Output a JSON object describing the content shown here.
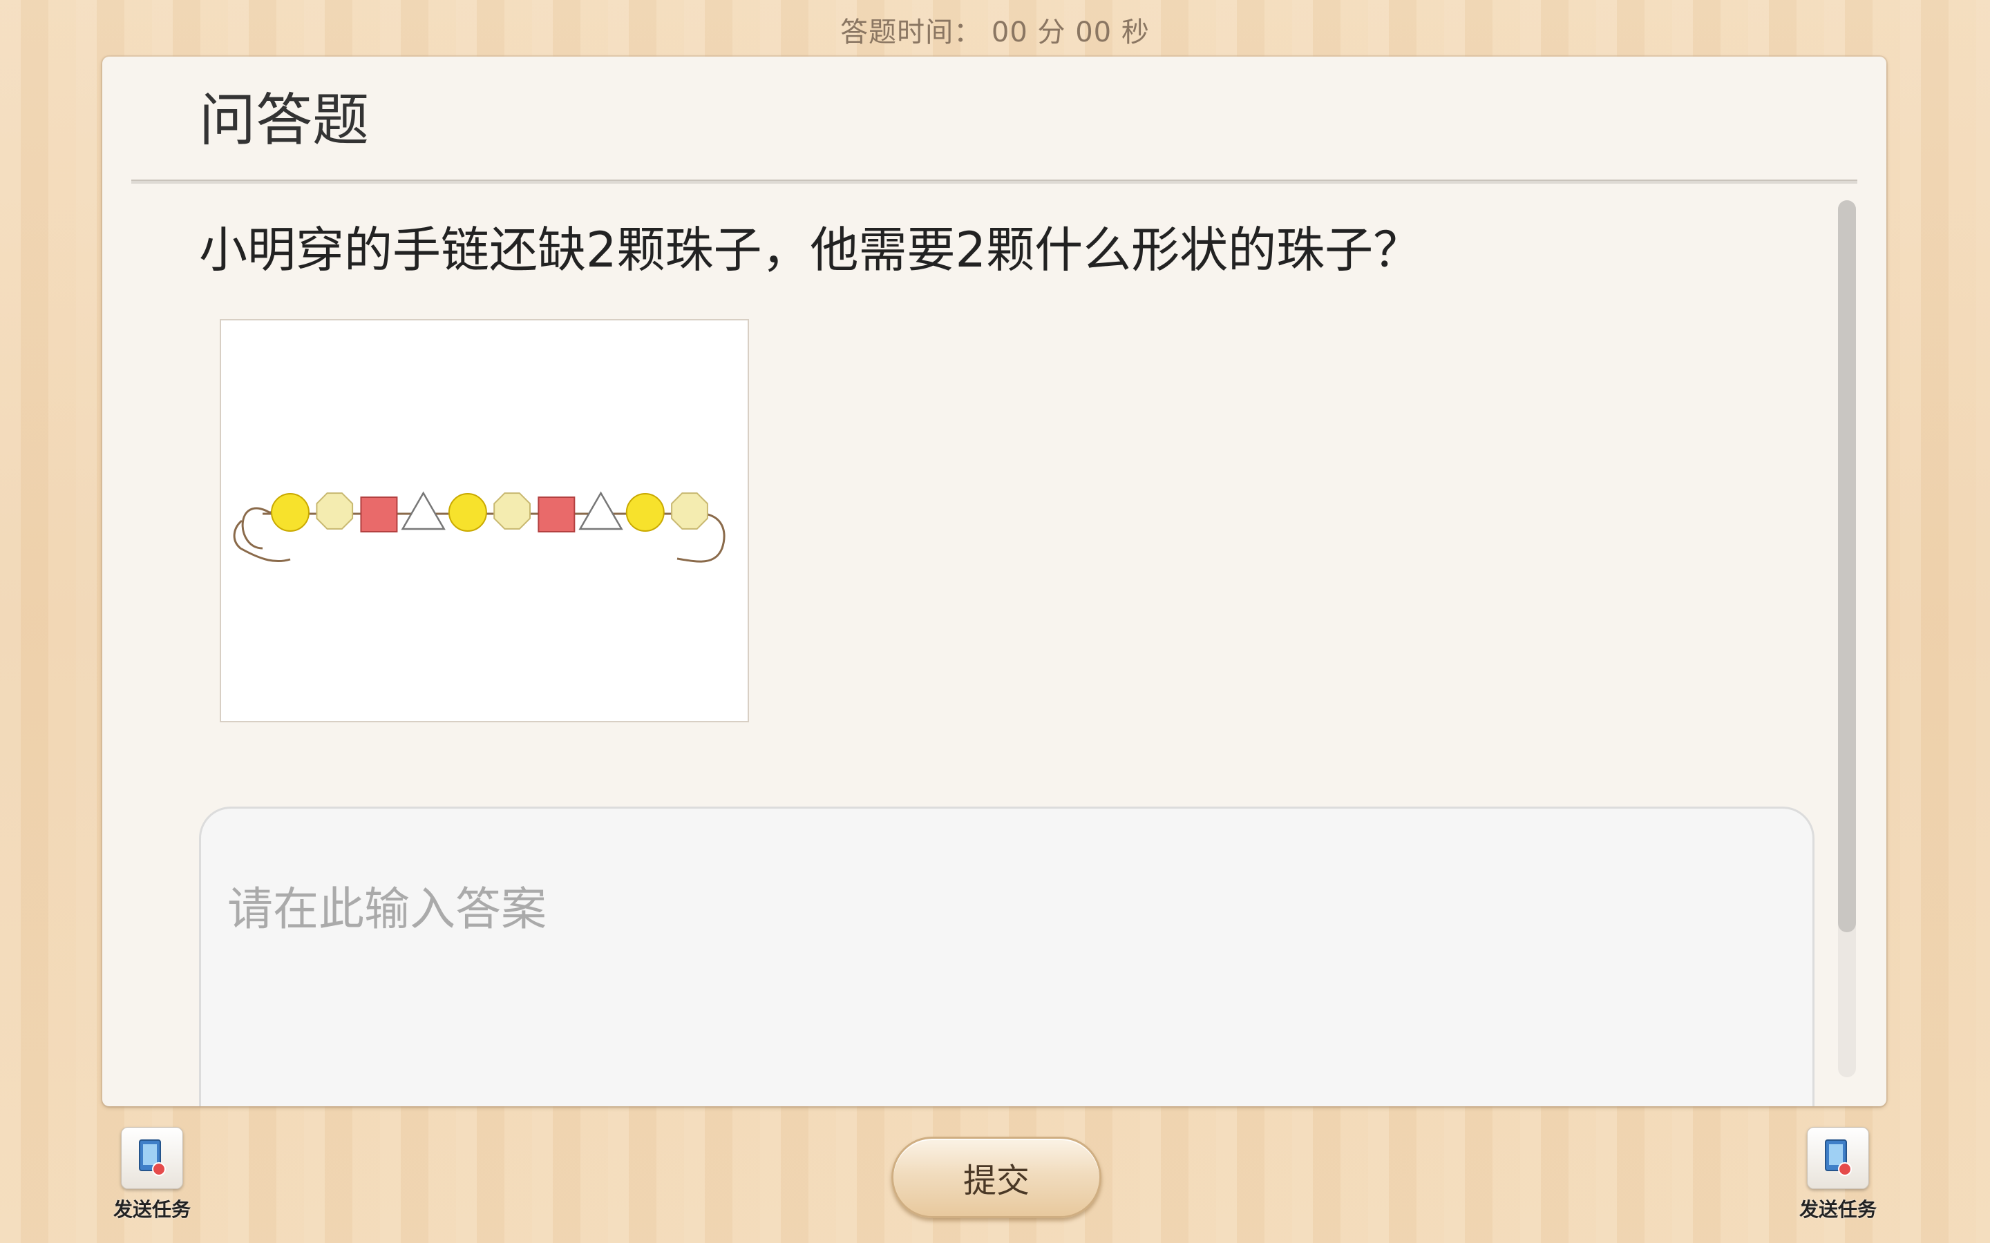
{
  "header": {
    "timer_text": "答题时间： 00 分 00 秒"
  },
  "card": {
    "title": "问答题",
    "question": "小明穿的手链还缺2颗珠子，他需要2颗什么形状的珠子？"
  },
  "bracelet_beads": [
    "yellow-circle",
    "pale-hexagon",
    "red-square",
    "white-triangle",
    "yellow-circle",
    "pale-hexagon",
    "red-square",
    "white-triangle",
    "yellow-circle",
    "pale-hexagon"
  ],
  "answer": {
    "placeholder": "请在此输入答案",
    "value": ""
  },
  "footer": {
    "left_button_label": "发送任务",
    "right_button_label": "发送任务",
    "submit_label": "提交"
  },
  "icons": {
    "zoom": "zoom-in-icon",
    "send_task": "send-task-icon"
  },
  "colors": {
    "bead_yellow": "#f7e22c",
    "bead_pale": "#f4ecb0",
    "bead_red": "#e96a6a",
    "string": "#8a6a4a"
  }
}
